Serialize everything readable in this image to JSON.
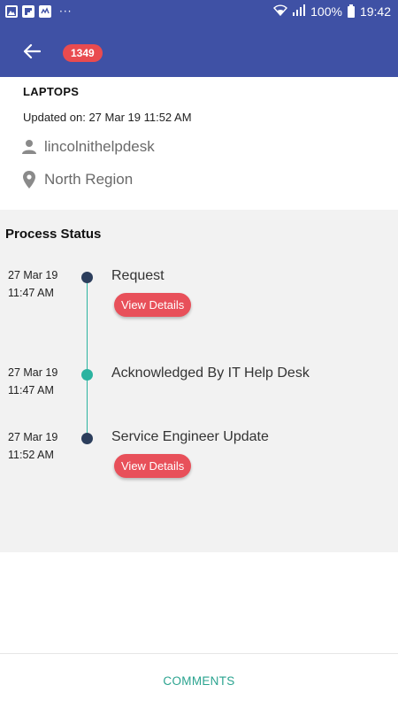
{
  "status_bar": {
    "notification_icons": [
      "gallery-icon",
      "flipboard-icon",
      "mail-app-icon"
    ],
    "overflow": "···",
    "battery": "100%",
    "time": "19:42"
  },
  "header": {
    "back_icon": "arrow-left-icon",
    "ticket_number": "1349",
    "badge_color": "#e94b4f",
    "bar_color": "#3f51a5"
  },
  "info": {
    "title": "LAPTOPS",
    "updated": "Updated on: 27 Mar 19 11:52 AM",
    "user_icon": "person-icon",
    "user": "lincolnithelpdesk",
    "location_icon": "location-pin-icon",
    "region": "North Region"
  },
  "process": {
    "title": "Process Status",
    "steps": [
      {
        "date": "27 Mar 19",
        "time": "11:47 AM",
        "label": "Request",
        "button": "View Details",
        "dot_color": "#2c3e5c"
      },
      {
        "date": "27 Mar 19",
        "time": "11:47 AM",
        "label": "Acknowledged By IT Help Desk",
        "dot_color": "#2bb3a0"
      },
      {
        "date": "27 Mar 19",
        "time": "11:52 AM",
        "label": "Service Engineer Update",
        "button": "View Details",
        "dot_color": "#2c3e5c"
      }
    ]
  },
  "footer": {
    "comments_label": "COMMENTS",
    "accent": "#2aa38f"
  }
}
